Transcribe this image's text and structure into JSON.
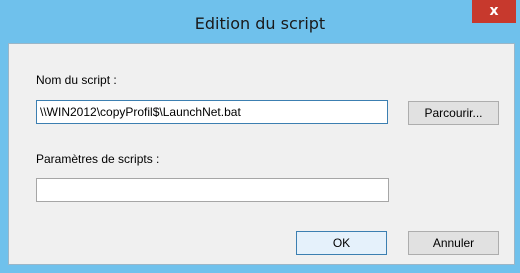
{
  "dialog": {
    "title": "Edition du script",
    "close_glyph": "x"
  },
  "form": {
    "script_name_label": "Nom du script :",
    "script_name_value": "\\\\WIN2012\\copyProfil$\\LaunchNet.bat",
    "browse_label": "Parcourir...",
    "script_params_label": "Paramètres de scripts :",
    "script_params_value": ""
  },
  "buttons": {
    "ok_label": "OK",
    "cancel_label": "Annuler"
  },
  "colors": {
    "titlebar": "#6fc1ec",
    "close_button": "#c7392d",
    "client_area": "#f0f0f0"
  }
}
